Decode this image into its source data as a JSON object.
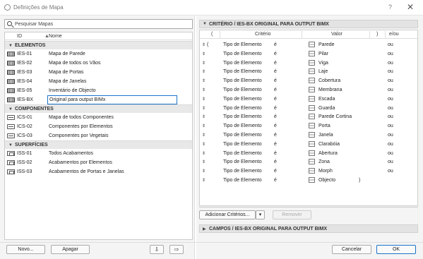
{
  "window": {
    "title": "Definições de Mapa",
    "help": "?",
    "close": "✕"
  },
  "search": {
    "placeholder": "Pesquisar Mapas"
  },
  "list": {
    "col_id": "ID",
    "col_name": "Nome",
    "groups": [
      {
        "label": "ELEMENTOS",
        "rows": [
          {
            "id": "IES-01",
            "name": "Mapa de Parede"
          },
          {
            "id": "IES-02",
            "name": "Mapa de todos os Vãos"
          },
          {
            "id": "IES-03",
            "name": "Mapa de Portas"
          },
          {
            "id": "IES-04",
            "name": "Mapa de Janelas"
          },
          {
            "id": "IES-05",
            "name": "Inventário de Objecto"
          },
          {
            "id": "IES-BX",
            "name": "Original para output BIMx"
          }
        ]
      },
      {
        "label": "COMPONENTES",
        "rows": [
          {
            "id": "ICS-01",
            "name": "Mapa de todos Componentes"
          },
          {
            "id": "ICS-02",
            "name": "Componentes por Elementos"
          },
          {
            "id": "ICS-03",
            "name": "Componentes por Vegetais"
          }
        ]
      },
      {
        "label": "SUPERFÍCIES",
        "rows": [
          {
            "id": "ISS-01",
            "name": "Todos Acabamentos"
          },
          {
            "id": "ISS-02",
            "name": "Acabamentos por Elementos"
          },
          {
            "id": "ISS-03",
            "name": "Acabamentos de Portas e Janelas"
          }
        ]
      }
    ]
  },
  "left_buttons": {
    "new": "Novo...",
    "delete": "Apagar"
  },
  "criteria": {
    "section_title": "CRITÉRIO / IES-BX ORIGINAL PARA OUTPUT BIMX",
    "col_open": "(",
    "col_criterion": "Critério",
    "col_value": "Valor",
    "col_close": ")",
    "col_andor": "e/ou",
    "rows": [
      {
        "open": "(",
        "criterion": "Tipo de Elemento",
        "op": "é",
        "value": "Parede",
        "icon": "wall-icon",
        "close": "",
        "andor": "ou"
      },
      {
        "open": "",
        "criterion": "Tipo de Elemento",
        "op": "é",
        "value": "Pilar",
        "icon": "column-icon",
        "close": "",
        "andor": "ou"
      },
      {
        "open": "",
        "criterion": "Tipo de Elemento",
        "op": "é",
        "value": "Viga",
        "icon": "beam-icon",
        "close": "",
        "andor": "ou"
      },
      {
        "open": "",
        "criterion": "Tipo de Elemento",
        "op": "é",
        "value": "Laje",
        "icon": "slab-icon",
        "close": "",
        "andor": "ou"
      },
      {
        "open": "",
        "criterion": "Tipo de Elemento",
        "op": "é",
        "value": "Cobertura",
        "icon": "roof-icon",
        "close": "",
        "andor": "ou"
      },
      {
        "open": "",
        "criterion": "Tipo de Elemento",
        "op": "é",
        "value": "Membrana",
        "icon": "shell-icon",
        "close": "",
        "andor": "ou"
      },
      {
        "open": "",
        "criterion": "Tipo de Elemento",
        "op": "é",
        "value": "Escada",
        "icon": "stair-icon",
        "close": "",
        "andor": "ou"
      },
      {
        "open": "",
        "criterion": "Tipo de Elemento",
        "op": "é",
        "value": "Guarda",
        "icon": "railing-icon",
        "close": "",
        "andor": "ou"
      },
      {
        "open": "",
        "criterion": "Tipo de Elemento",
        "op": "é",
        "value": "Parede Cortina",
        "icon": "curtain-wall-icon",
        "close": "",
        "andor": "ou"
      },
      {
        "open": "",
        "criterion": "Tipo de Elemento",
        "op": "é",
        "value": "Porta",
        "icon": "door-icon",
        "close": "",
        "andor": "ou"
      },
      {
        "open": "",
        "criterion": "Tipo de Elemento",
        "op": "é",
        "value": "Janela",
        "icon": "window-icon",
        "close": "",
        "andor": "ou"
      },
      {
        "open": "",
        "criterion": "Tipo de Elemento",
        "op": "é",
        "value": "Clarabóia",
        "icon": "skylight-icon",
        "close": "",
        "andor": "ou"
      },
      {
        "open": "",
        "criterion": "Tipo de Elemento",
        "op": "é",
        "value": "Abertura",
        "icon": "opening-icon",
        "close": "",
        "andor": "ou"
      },
      {
        "open": "",
        "criterion": "Tipo de Elemento",
        "op": "é",
        "value": "Zona",
        "icon": "zone-icon",
        "close": "",
        "andor": "ou"
      },
      {
        "open": "",
        "criterion": "Tipo de Elemento",
        "op": "é",
        "value": "Morph",
        "icon": "morph-icon",
        "close": "",
        "andor": "ou"
      },
      {
        "open": "",
        "criterion": "Tipo de Elemento",
        "op": "é",
        "value": "Objecto",
        "icon": "object-icon",
        "close": ")",
        "andor": ""
      }
    ],
    "add_button": "Adicionar Critérios...",
    "remove_button": "Remover"
  },
  "fields_section": {
    "title": "CAMPOS / IES-BX ORIGINAL PARA OUTPUT BIMX"
  },
  "footer": {
    "cancel": "Cancelar",
    "ok": "OK"
  }
}
